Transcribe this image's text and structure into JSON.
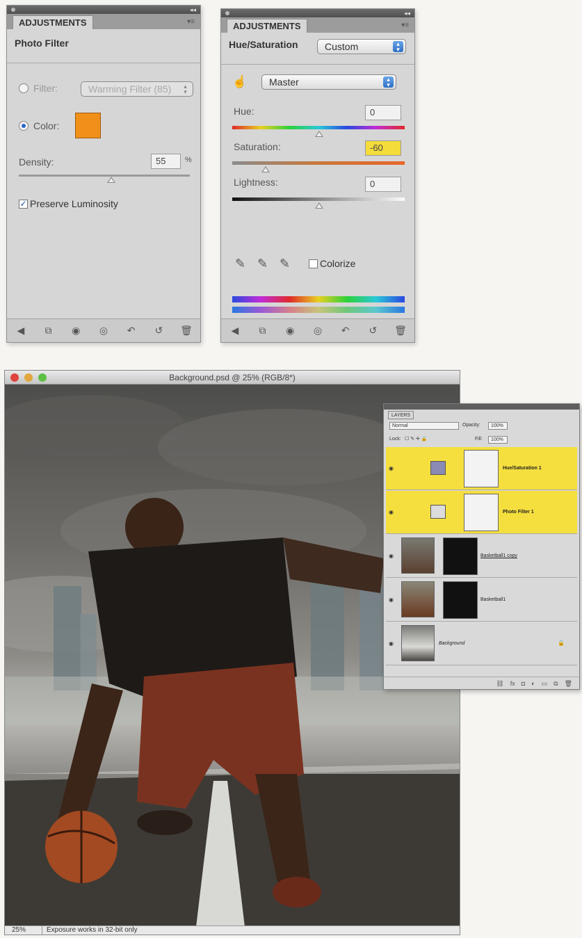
{
  "photo_filter_panel": {
    "tab": "ADJUSTMENTS",
    "title": "Photo Filter",
    "filter_label": "Filter:",
    "filter_value": "Warming Filter (85)",
    "color_label": "Color:",
    "color_swatch": "#f0901a",
    "density_label": "Density:",
    "density_value": "55",
    "density_unit": "%",
    "density_level_percent": 55,
    "preserve_luminosity_label": "Preserve Luminosity",
    "preserve_luminosity_checked": true
  },
  "hue_sat_panel": {
    "tab": "ADJUSTMENTS",
    "title": "Hue/Saturation",
    "preset_value": "Custom",
    "channel_value": "Master",
    "hue_label": "Hue:",
    "hue_value": "0",
    "saturation_label": "Saturation:",
    "saturation_value": "-60",
    "lightness_label": "Lightness:",
    "lightness_value": "0",
    "colorize_label": "Colorize",
    "colorize_checked": false
  },
  "document": {
    "title": "Background.psd @ 25% (RGB/8*)",
    "zoom": "25%",
    "status_message": "Exposure works in 32-bit only"
  },
  "layers_panel": {
    "tab": "LAYERS",
    "blend_mode": "Normal",
    "opacity_label": "Opacity:",
    "opacity_value": "100%",
    "lock_label": "Lock:",
    "fill_label": "Fill:",
    "fill_value": "100%",
    "layers": [
      {
        "name": "Hue/Saturation 1",
        "selected": true
      },
      {
        "name": "Photo Filter 1",
        "selected": true
      },
      {
        "name": "Basketball1 copy",
        "selected": false
      },
      {
        "name": "Basketball1",
        "selected": false
      },
      {
        "name": "Background",
        "selected": false
      }
    ]
  }
}
